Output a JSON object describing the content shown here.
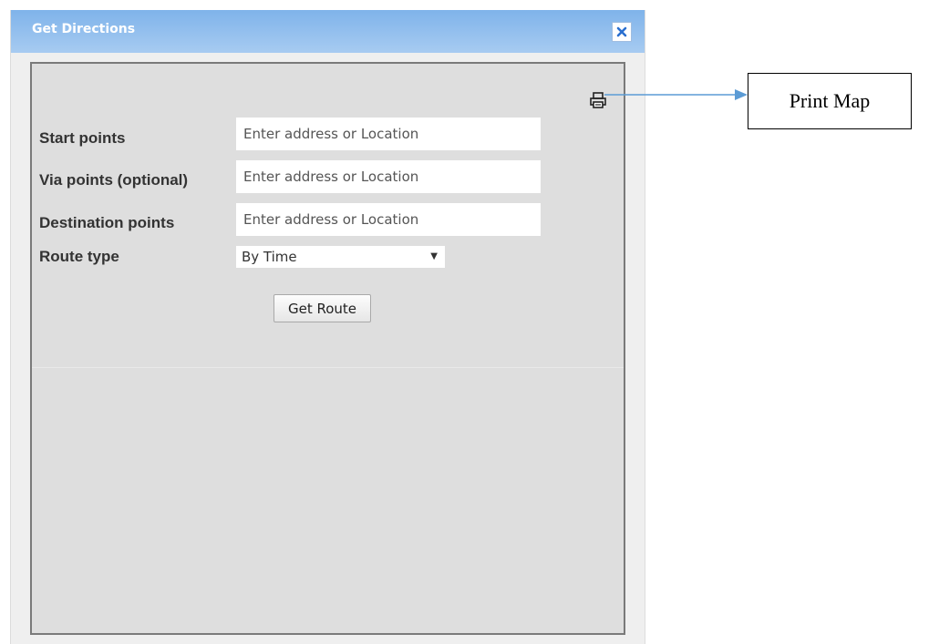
{
  "dialog": {
    "title": "Get Directions",
    "close_icon": "close-icon",
    "print_icon": "printer-icon"
  },
  "form": {
    "start": {
      "label": "Start points",
      "value": "",
      "placeholder": "Enter address or Location"
    },
    "via": {
      "label": "Via points (optional)",
      "value": "",
      "placeholder": "Enter address or Location"
    },
    "destination": {
      "label": "Destination points",
      "value": "",
      "placeholder": "Enter address or Location"
    },
    "route_type": {
      "label": "Route type",
      "selected": "By Time"
    },
    "submit_label": "Get Route"
  },
  "annotation": {
    "label": "Print Map",
    "arrow_color": "#5b9bd5"
  },
  "colors": {
    "titlebar": "#8ab8ec",
    "close_icon": "#2a6fcf",
    "panel_background": "#dedede",
    "panel_border": "#7a7a7a"
  }
}
